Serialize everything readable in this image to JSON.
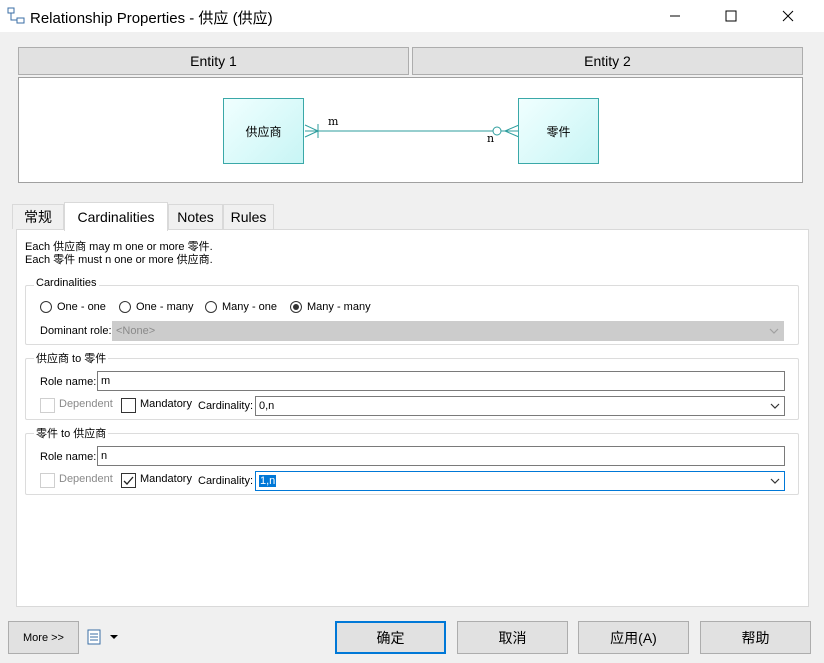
{
  "window": {
    "title": "Relationship Properties - 供应 (供应)"
  },
  "entities": {
    "entity1_header": "Entity 1",
    "entity2_header": "Entity 2",
    "entity1_name": "供应商",
    "entity2_name": "零件",
    "role1_label": "m",
    "role2_label": "n"
  },
  "tabs": [
    {
      "label": "常规",
      "active": false
    },
    {
      "label": "Cardinalities",
      "active": true
    },
    {
      "label": "Notes",
      "active": false
    },
    {
      "label": "Rules",
      "active": false
    }
  ],
  "description": {
    "line1": "Each 供应商 may m one or more 零件.",
    "line2": "Each 零件 must n one or more 供应商."
  },
  "cardinalities": {
    "group_title": "Cardinalities",
    "options": [
      {
        "label": "One - one",
        "selected": false
      },
      {
        "label": "One - many",
        "selected": false
      },
      {
        "label": "Many - one",
        "selected": false
      },
      {
        "label": "Many - many",
        "selected": true
      }
    ],
    "dominant_role_label": "Dominant role:",
    "dominant_role_value": "<None>"
  },
  "role1": {
    "group_title": "供应商 to 零件",
    "role_name_label": "Role name:",
    "role_name_value": "m",
    "dependent_label": "Dependent",
    "dependent_checked": false,
    "mandatory_label": "Mandatory",
    "mandatory_checked": false,
    "cardinality_label": "Cardinality:",
    "cardinality_value": "0,n"
  },
  "role2": {
    "group_title": "零件 to 供应商",
    "role_name_label": "Role name:",
    "role_name_value": "n",
    "dependent_label": "Dependent",
    "dependent_checked": false,
    "mandatory_label": "Mandatory",
    "mandatory_checked": true,
    "cardinality_label": "Cardinality:",
    "cardinality_value": "1,n"
  },
  "footer": {
    "more_label": "More >>",
    "ok_label": "确定",
    "cancel_label": "取消",
    "apply_label": "应用(A)",
    "help_label": "帮助"
  },
  "colors": {
    "accent": "#0078d7",
    "entity_border": "#3aa8a8",
    "relation_line": "#2e9e9e"
  }
}
